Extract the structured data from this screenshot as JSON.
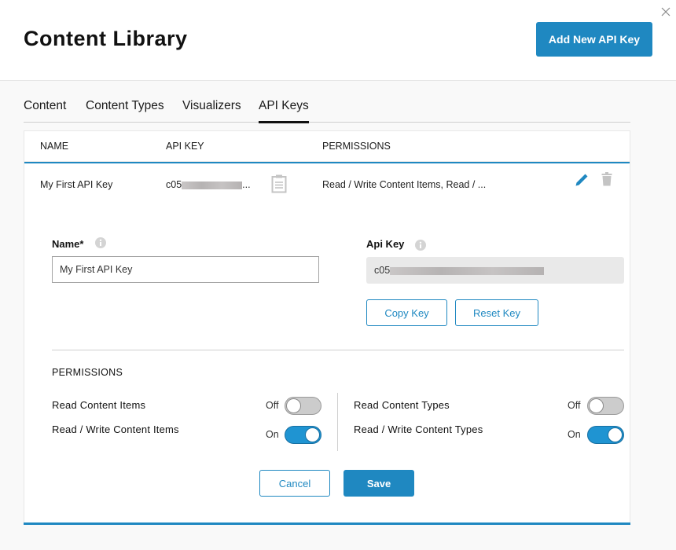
{
  "header": {
    "title": "Content Library",
    "add_button_label": "Add New API Key",
    "close_icon": "close-icon"
  },
  "tabs": [
    {
      "label": "Content",
      "active": false
    },
    {
      "label": "Content Types",
      "active": false
    },
    {
      "label": "Visualizers",
      "active": false
    },
    {
      "label": "API Keys",
      "active": true
    }
  ],
  "table": {
    "columns": [
      "NAME",
      "API KEY",
      "PERMISSIONS"
    ],
    "rows": [
      {
        "name": "My First API Key",
        "api_key_prefix": "c05",
        "api_key_suffix": "...",
        "permissions": "Read / Write Content Items, Read / ...",
        "icons": [
          "clipboard-icon",
          "edit-icon",
          "trash-icon"
        ]
      }
    ]
  },
  "form": {
    "name_label": "Name*",
    "name_value": "My First API Key",
    "api_key_label": "Api Key",
    "api_key_prefix": "c05",
    "copy_key_label": "Copy Key",
    "reset_key_label": "Reset Key",
    "permissions_heading": "PERMISSIONS",
    "permissions": [
      {
        "label": "Read Content Items",
        "state_label": "Off",
        "on": false
      },
      {
        "label": "Read / Write Content Items",
        "state_label": "On",
        "on": true
      },
      {
        "label": "Read Content Types",
        "state_label": "Off",
        "on": false
      },
      {
        "label": "Read / Write Content Types",
        "state_label": "On",
        "on": true
      }
    ],
    "cancel_label": "Cancel",
    "save_label": "Save"
  },
  "colors": {
    "accent": "#1f88c1",
    "toggle_on": "#1f94d2",
    "toggle_off": "#cccccc"
  }
}
